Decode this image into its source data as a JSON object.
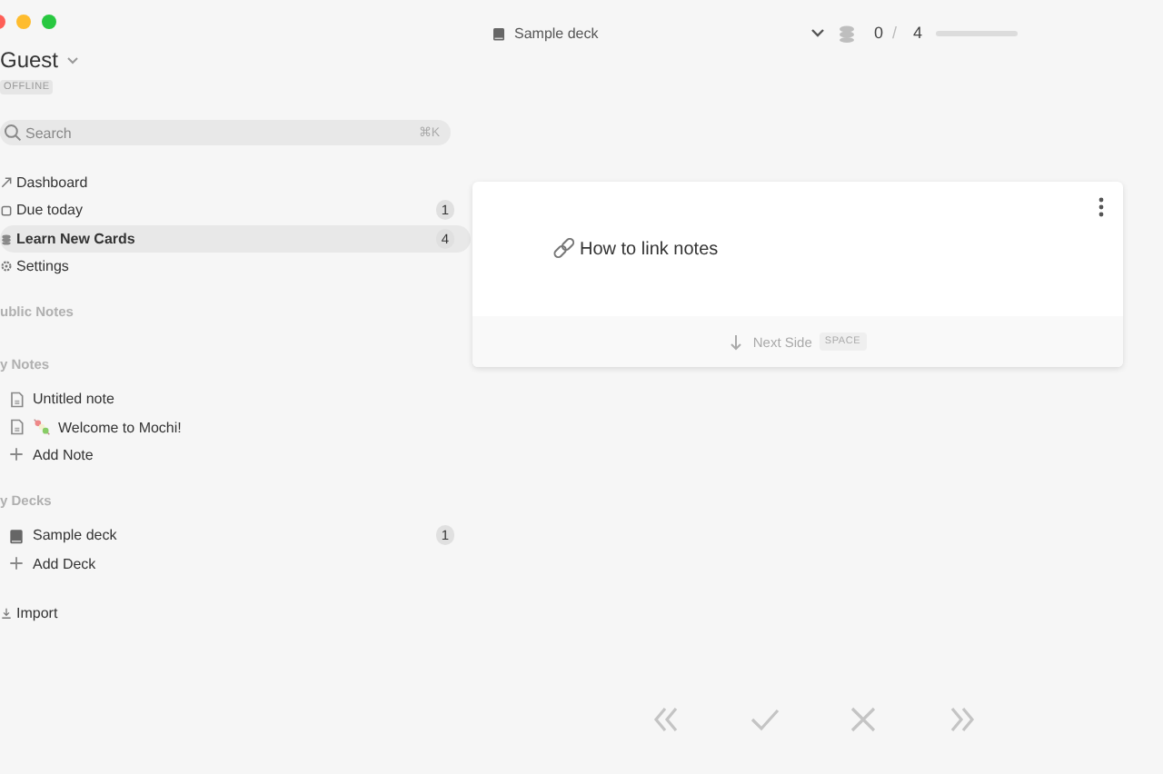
{
  "account": {
    "name": "Guest",
    "status": "OFFLINE"
  },
  "search": {
    "placeholder": "Search",
    "shortcut": "⌘K"
  },
  "nav": [
    {
      "label": "Dashboard",
      "kind": "dashboard",
      "selected": false
    },
    {
      "label": "Due today",
      "kind": "due",
      "count": "1",
      "selected": false
    },
    {
      "label": "Learn New Cards",
      "kind": "learn",
      "count": "4",
      "selected": true
    },
    {
      "label": "Settings",
      "kind": "settings",
      "selected": false
    }
  ],
  "sections": [
    {
      "title": "ublic Notes"
    },
    {
      "title": "y Notes",
      "items": [
        {
          "label": "Untitled note",
          "kind": "note"
        },
        {
          "label": "Welcome to Mochi!",
          "kind": "note-dango"
        },
        {
          "label": "Add Note",
          "kind": "add"
        }
      ]
    },
    {
      "title": "y Decks",
      "items": [
        {
          "label": "Sample deck",
          "kind": "deck",
          "count": "1"
        },
        {
          "label": "Add Deck",
          "kind": "add"
        }
      ]
    }
  ],
  "import": {
    "label": "Import"
  },
  "header": {
    "deck": "Sample deck",
    "done": "0",
    "separator": "/",
    "total": "4",
    "level": 0
  },
  "card": {
    "title": "How to link notes",
    "next": "Next Side",
    "key": "SPACE"
  },
  "actions": [
    {
      "kind": "back"
    },
    {
      "kind": "check"
    },
    {
      "kind": "cross"
    },
    {
      "kind": "forward"
    }
  ]
}
